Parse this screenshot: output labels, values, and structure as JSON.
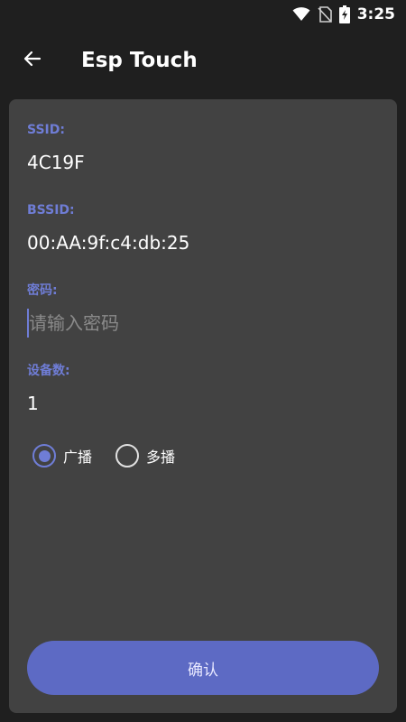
{
  "status_bar": {
    "time": "3:25",
    "icons": [
      "wifi-icon",
      "no-sim-icon",
      "battery-charging-icon"
    ]
  },
  "app_bar": {
    "back_icon": "arrow-left-icon",
    "title": "Esp Touch"
  },
  "form": {
    "ssid": {
      "label": "SSID:",
      "value": "4C19F"
    },
    "bssid": {
      "label": "BSSID:",
      "value": "00:AA:9f:c4:db:25"
    },
    "password": {
      "label": "密码:",
      "value": "",
      "placeholder": "请输入密码"
    },
    "device_count": {
      "label": "设备数:",
      "value": "1"
    },
    "mode": {
      "options": [
        {
          "label": "广播",
          "selected": true
        },
        {
          "label": "多播",
          "selected": false
        }
      ]
    },
    "confirm_label": "确认"
  },
  "colors": {
    "accent": "#6f7dd6",
    "button": "#5d6ac4",
    "card": "#424242",
    "background": "#1f1f1f"
  }
}
